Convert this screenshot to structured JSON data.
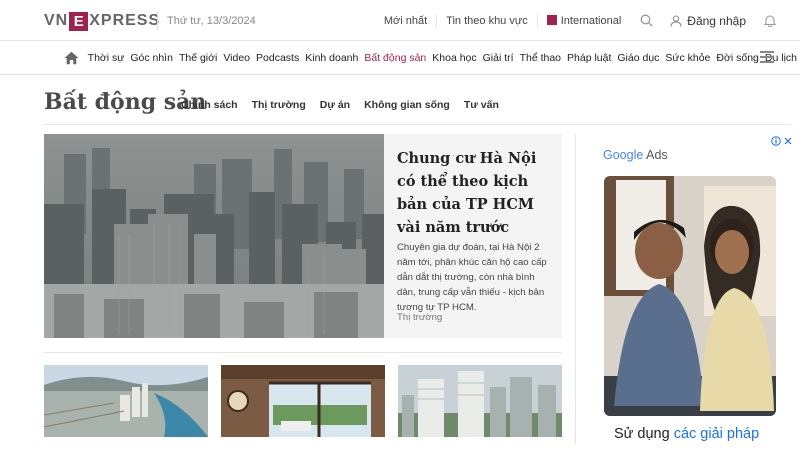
{
  "header": {
    "logo_left": "VN",
    "logo_box": "E",
    "logo_right": "XPRESS",
    "date": "Thứ tư, 13/3/2024",
    "links": [
      "Mới nhất",
      "Tin theo khu vực",
      "International"
    ],
    "login_label": "Đăng nhập"
  },
  "nav": {
    "items": [
      "Thời sự",
      "Góc nhìn",
      "Thế giới",
      "Video",
      "Podcasts",
      "Kinh doanh",
      "Bất động sản",
      "Khoa học",
      "Giải trí",
      "Thể thao",
      "Pháp luật",
      "Giáo dục",
      "Sức khỏe",
      "Đời sống",
      "Du lịch"
    ],
    "active": "Bất động sản"
  },
  "section": {
    "title": "Bất động sản",
    "subnav": [
      "Chính sách",
      "Thị trường",
      "Dự án",
      "Không gian sống",
      "Tư vấn"
    ]
  },
  "featured": {
    "headline": "Chung cư Hà Nội có thể theo kịch bản của TP HCM vài năm trước",
    "summary": "Chuyên gia dự đoán, tại Hà Nội 2 năm tới, phân khúc căn hộ cao cấp dẫn dắt thị trường, còn nhà bình dân, trung cấp vẫn thiếu - kịch bản tương tự TP HCM.",
    "category": "Thị trường"
  },
  "ad": {
    "label_google": "Google",
    "label_ads": "Ads",
    "caption_start": "Sử dụng ",
    "caption_link": "các giải pháp"
  },
  "colors": {
    "brand": "#9f224e",
    "text": "#222222",
    "divider": "#e5e5e5"
  }
}
